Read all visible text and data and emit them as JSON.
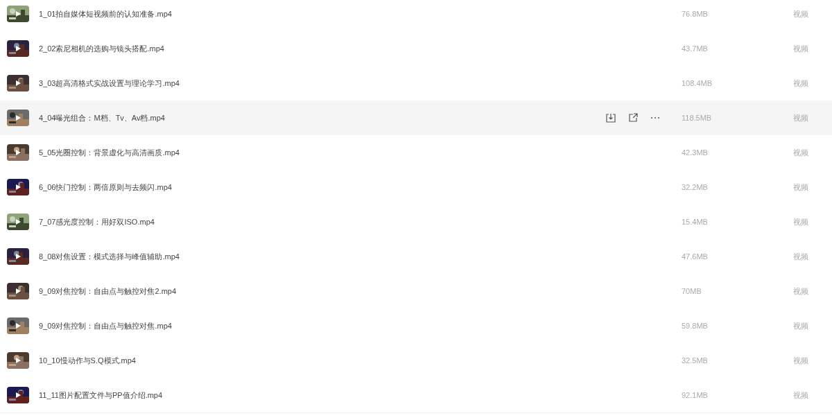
{
  "files": [
    {
      "name": "1_01拍自媒体短视频前的认知准备.mp4",
      "size": "76.8MB",
      "type": "视频",
      "hovered": false
    },
    {
      "name": "2_02索尼相机的选购与镜头搭配.mp4",
      "size": "43.7MB",
      "type": "视频",
      "hovered": false
    },
    {
      "name": "3_03超高清格式实战设置与理论学习.mp4",
      "size": "108.4MB",
      "type": "视频",
      "hovered": false
    },
    {
      "name": "4_04曝光组合：M档、Tv、Av档.mp4",
      "size": "118.5MB",
      "type": "视频",
      "hovered": true
    },
    {
      "name": "5_05光圈控制：背景虚化与高清画质.mp4",
      "size": "42.3MB",
      "type": "视频",
      "hovered": false
    },
    {
      "name": "6_06快门控制：两倍原则与去频闪.mp4",
      "size": "32.2MB",
      "type": "视频",
      "hovered": false
    },
    {
      "name": "7_07感光度控制：用好双ISO.mp4",
      "size": "15.4MB",
      "type": "视频",
      "hovered": false
    },
    {
      "name": "8_08对焦设置：模式选择与峰值辅助.mp4",
      "size": "47.6MB",
      "type": "视频",
      "hovered": false
    },
    {
      "name": "9_09对焦控制：自由点与触控对焦2.mp4",
      "size": "70MB",
      "type": "视频",
      "hovered": false
    },
    {
      "name": "9_09对焦控制：自由点与触控对焦.mp4",
      "size": "59.8MB",
      "type": "视频",
      "hovered": false
    },
    {
      "name": "10_10慢动作与S.Q模式.mp4",
      "size": "32.5MB",
      "type": "视频",
      "hovered": false
    },
    {
      "name": "11_11图片配置文件与PP值介绍.mp4",
      "size": "92.1MB",
      "type": "视频",
      "hovered": false
    }
  ]
}
